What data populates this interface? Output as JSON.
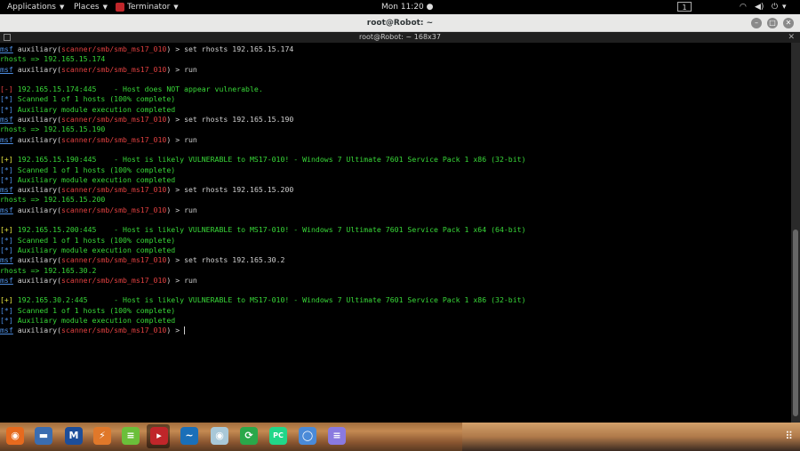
{
  "topbar": {
    "applications": "Applications",
    "places": "Places",
    "app_name": "Terminator",
    "clock": "Mon 11:20",
    "workspace": "1"
  },
  "window": {
    "title": "root@Robot: ~",
    "subtitle": "root@Robot: ~ 168x37"
  },
  "terminal": {
    "prompt_msf": "msf",
    "prompt_module": "auxiliary(scanner/smb/smb_ms17_010)",
    "lines": [
      {
        "type": "cmd",
        "text": " > set rhosts 192.165.15.174"
      },
      {
        "type": "plain",
        "text": "rhosts => 192.165.15.174"
      },
      {
        "type": "cmd",
        "text": " > run"
      },
      {
        "type": "blank",
        "text": ""
      },
      {
        "type": "status",
        "mark": "[-]",
        "mark_color": "red",
        "text": " 192.165.15.174:445    - Host does NOT appear vulnerable."
      },
      {
        "type": "status",
        "mark": "[*]",
        "mark_color": "blu",
        "text": " Scanned 1 of 1 hosts (100% complete)"
      },
      {
        "type": "status",
        "mark": "[*]",
        "mark_color": "blu",
        "text": " Auxiliary module execution completed"
      },
      {
        "type": "cmd",
        "text": " > set rhosts 192.165.15.190"
      },
      {
        "type": "plain",
        "text": "rhosts => 192.165.15.190"
      },
      {
        "type": "cmd",
        "text": " > run"
      },
      {
        "type": "blank",
        "text": ""
      },
      {
        "type": "status",
        "mark": "[+]",
        "mark_color": "yel",
        "text": " 192.165.15.190:445    - Host is likely VULNERABLE to MS17-010! - Windows 7 Ultimate 7601 Service Pack 1 x86 (32-bit)"
      },
      {
        "type": "status",
        "mark": "[*]",
        "mark_color": "blu",
        "text": " Scanned 1 of 1 hosts (100% complete)"
      },
      {
        "type": "status",
        "mark": "[*]",
        "mark_color": "blu",
        "text": " Auxiliary module execution completed"
      },
      {
        "type": "cmd",
        "text": " > set rhosts 192.165.15.200"
      },
      {
        "type": "plain",
        "text": "rhosts => 192.165.15.200"
      },
      {
        "type": "cmd",
        "text": " > run"
      },
      {
        "type": "blank",
        "text": ""
      },
      {
        "type": "status",
        "mark": "[+]",
        "mark_color": "yel",
        "text": " 192.165.15.200:445    - Host is likely VULNERABLE to MS17-010! - Windows 7 Ultimate 7601 Service Pack 1 x64 (64-bit)"
      },
      {
        "type": "status",
        "mark": "[*]",
        "mark_color": "blu",
        "text": " Scanned 1 of 1 hosts (100% complete)"
      },
      {
        "type": "status",
        "mark": "[*]",
        "mark_color": "blu",
        "text": " Auxiliary module execution completed"
      },
      {
        "type": "cmd",
        "text": " > set rhosts 192.165.30.2"
      },
      {
        "type": "plain",
        "text": "rhosts => 192.165.30.2"
      },
      {
        "type": "cmd",
        "text": " > run"
      },
      {
        "type": "blank",
        "text": ""
      },
      {
        "type": "status",
        "mark": "[+]",
        "mark_color": "yel",
        "text": " 192.165.30.2:445      - Host is likely VULNERABLE to MS17-010! - Windows 7 Ultimate 7601 Service Pack 1 x86 (32-bit)"
      },
      {
        "type": "status",
        "mark": "[*]",
        "mark_color": "blu",
        "text": " Scanned 1 of 1 hosts (100% complete)"
      },
      {
        "type": "status",
        "mark": "[*]",
        "mark_color": "blu",
        "text": " Auxiliary module execution completed"
      },
      {
        "type": "cmd",
        "text": " > ",
        "cursor": true
      }
    ]
  },
  "dock": {
    "icons": [
      {
        "name": "firefox-icon",
        "glyph": "◉",
        "color": "#e66a1e"
      },
      {
        "name": "files-icon",
        "glyph": "▬",
        "color": "#3b6db0"
      },
      {
        "name": "metasploit-icon",
        "glyph": "M",
        "color": "#1d4e9a"
      },
      {
        "name": "burpsuite-icon",
        "glyph": "⚡",
        "color": "#e0782a"
      },
      {
        "name": "leafpad-icon",
        "glyph": "≡",
        "color": "#6bbf3a"
      },
      {
        "name": "terminator-icon",
        "glyph": "▸",
        "color": "#c0262a"
      },
      {
        "name": "wireshark-icon",
        "glyph": "~",
        "color": "#1a6fb8"
      },
      {
        "name": "eye-icon",
        "glyph": "◉",
        "color": "#a9c8d8"
      },
      {
        "name": "sync-icon",
        "glyph": "⟳",
        "color": "#2aa84a"
      },
      {
        "name": "pycharm-icon",
        "glyph": "PC",
        "color": "#21d789"
      },
      {
        "name": "chromium-icon",
        "glyph": "◯",
        "color": "#4a8ad8"
      },
      {
        "name": "notes-icon",
        "glyph": "≡",
        "color": "#8a7ae0"
      }
    ],
    "show_apps_glyph": "⠿"
  }
}
